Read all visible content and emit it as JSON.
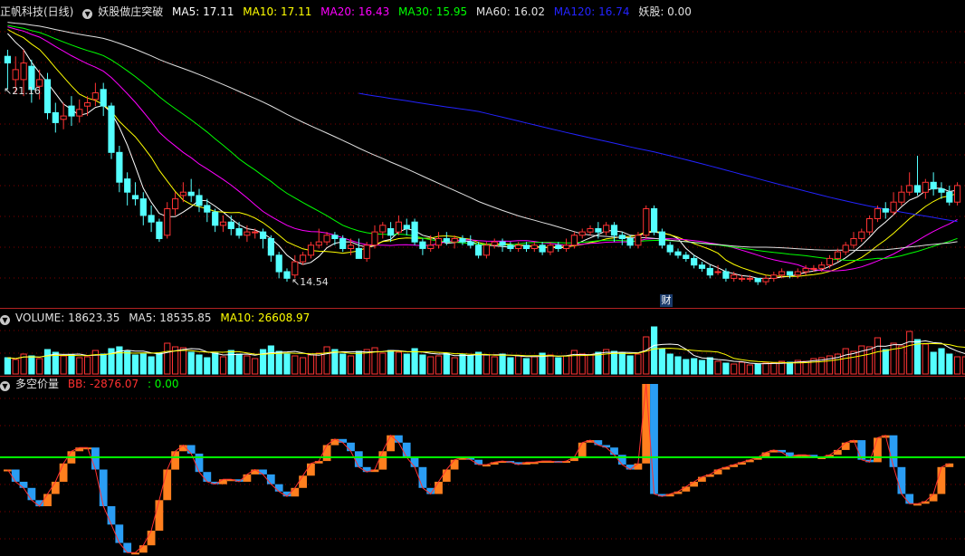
{
  "main_panel": {
    "stock_name": "正帆科技(日线)",
    "indicator_name": "妖股做庄突破",
    "ma_labels": [
      {
        "text": "MA5: 17.11",
        "color": "#ffffff"
      },
      {
        "text": "MA10: 17.11",
        "color": "#ffff00"
      },
      {
        "text": "MA20: 16.43",
        "color": "#ff00ff"
      },
      {
        "text": "MA30: 15.95",
        "color": "#00ff00"
      },
      {
        "text": "MA60: 16.02",
        "color": "#e0e0e0"
      },
      {
        "text": "MA120: 16.74",
        "color": "#2323ff"
      },
      {
        "text": "妖股: 0.00",
        "color": "#e0e0e0"
      }
    ],
    "high_marker": "21.16",
    "low_marker": "14.54",
    "cai_badge": "财"
  },
  "volume_panel": {
    "labels": [
      {
        "text": "VOLUME: 18623.35",
        "color": "#e0e0e0"
      },
      {
        "text": "MA5: 18535.85",
        "color": "#e0e0e0"
      },
      {
        "text": "MA10: 26608.97",
        "color": "#ffff00"
      }
    ]
  },
  "bb_panel": {
    "name": "多空价量",
    "labels": [
      {
        "text": "BB: -2876.07",
        "color": "#ff3030"
      },
      {
        "text": ": 0.00",
        "color": "#00ff00"
      }
    ]
  },
  "colors": {
    "up": "#ff3333",
    "down": "#54ffff",
    "bb_up": "#ff7f1e",
    "bb_down": "#2a9df4",
    "zero_line": "#00ff00",
    "grid": "#800000"
  },
  "chart_data": [
    {
      "type": "candlestick",
      "panel": "price",
      "ylim": [
        14.2,
        22.4
      ],
      "candles": [
        [
          21.3,
          21.1,
          21.5,
          20.3
        ],
        [
          20.6,
          20.9,
          21.3,
          20.2
        ],
        [
          20.6,
          21.1,
          21.5,
          20.1
        ],
        [
          21.0,
          20.3,
          21.2,
          19.9
        ],
        [
          20.4,
          20.6,
          20.9,
          20.0
        ],
        [
          20.6,
          19.6,
          20.8,
          19.4
        ],
        [
          19.6,
          19.3,
          19.9,
          19.0
        ],
        [
          19.4,
          19.5,
          19.9,
          19.1
        ],
        [
          19.8,
          19.5,
          20.1,
          19.2
        ],
        [
          19.5,
          19.7,
          20.0,
          19.3
        ],
        [
          19.8,
          19.9,
          20.1,
          19.5
        ],
        [
          20.0,
          20.2,
          20.5,
          19.8
        ],
        [
          20.3,
          19.8,
          20.5,
          19.5
        ],
        [
          19.8,
          18.4,
          19.9,
          18.2
        ],
        [
          18.4,
          17.5,
          18.6,
          17.2
        ],
        [
          17.6,
          17.2,
          17.8,
          16.8
        ],
        [
          17.1,
          17.0,
          17.5,
          16.8
        ],
        [
          17.0,
          16.5,
          17.2,
          16.2
        ],
        [
          16.5,
          16.3,
          16.8,
          16.0
        ],
        [
          16.3,
          15.8,
          16.4,
          15.7
        ],
        [
          15.9,
          16.7,
          16.9,
          15.8
        ],
        [
          16.7,
          17.0,
          17.2,
          16.5
        ],
        [
          17.1,
          17.2,
          17.5,
          16.9
        ],
        [
          17.2,
          17.1,
          17.6,
          16.9
        ],
        [
          17.1,
          16.8,
          17.3,
          16.6
        ],
        [
          16.8,
          16.6,
          17.0,
          16.3
        ],
        [
          16.6,
          16.2,
          16.7,
          16.0
        ],
        [
          16.2,
          16.3,
          16.5,
          16.0
        ],
        [
          16.3,
          16.1,
          16.5,
          15.9
        ],
        [
          16.1,
          15.9,
          16.3,
          15.8
        ],
        [
          15.9,
          16.0,
          16.2,
          15.7
        ],
        [
          16.0,
          16.0,
          16.1,
          15.8
        ],
        [
          16.0,
          15.8,
          16.1,
          15.5
        ],
        [
          15.8,
          15.3,
          15.9,
          15.1
        ],
        [
          15.3,
          14.8,
          15.4,
          14.6
        ],
        [
          14.8,
          14.6,
          14.9,
          14.5
        ],
        [
          14.7,
          15.1,
          15.3,
          14.6
        ],
        [
          15.1,
          15.3,
          15.4,
          15.0
        ],
        [
          15.3,
          15.6,
          15.7,
          15.2
        ],
        [
          15.6,
          15.7,
          16.1,
          15.5
        ],
        [
          15.7,
          15.9,
          16.0,
          15.6
        ],
        [
          15.9,
          15.8,
          16.0,
          15.6
        ],
        [
          15.8,
          15.5,
          15.9,
          15.4
        ],
        [
          15.5,
          15.6,
          15.8,
          15.3
        ],
        [
          15.5,
          15.2,
          15.8,
          15.2
        ],
        [
          15.2,
          15.6,
          15.7,
          15.1
        ],
        [
          15.6,
          16.0,
          16.2,
          15.5
        ],
        [
          16.0,
          16.2,
          16.3,
          15.8
        ],
        [
          16.1,
          15.9,
          16.3,
          15.7
        ],
        [
          16.0,
          16.3,
          16.5,
          15.9
        ],
        [
          16.2,
          16.1,
          16.4,
          15.9
        ],
        [
          16.3,
          15.7,
          16.4,
          15.6
        ],
        [
          15.7,
          15.5,
          15.8,
          15.3
        ],
        [
          15.5,
          15.6,
          15.9,
          15.4
        ],
        [
          15.6,
          15.8,
          16.0,
          15.5
        ],
        [
          15.8,
          15.7,
          16.0,
          15.6
        ],
        [
          15.7,
          15.8,
          15.9,
          15.5
        ],
        [
          15.8,
          15.7,
          15.9,
          15.6
        ],
        [
          15.7,
          15.6,
          15.9,
          15.5
        ],
        [
          15.6,
          15.3,
          15.7,
          15.2
        ],
        [
          15.3,
          15.6,
          15.7,
          15.2
        ],
        [
          15.6,
          15.7,
          15.8,
          15.5
        ],
        [
          15.7,
          15.6,
          15.8,
          15.4
        ],
        [
          15.6,
          15.5,
          15.7,
          15.4
        ],
        [
          15.5,
          15.6,
          15.7,
          15.4
        ],
        [
          15.6,
          15.5,
          15.7,
          15.4
        ],
        [
          15.5,
          15.6,
          15.7,
          15.4
        ],
        [
          15.6,
          15.4,
          15.7,
          15.3
        ],
        [
          15.4,
          15.6,
          15.7,
          15.3
        ],
        [
          15.6,
          15.5,
          15.7,
          15.4
        ],
        [
          15.5,
          15.6,
          15.8,
          15.4
        ],
        [
          15.6,
          15.9,
          16.0,
          15.5
        ],
        [
          15.9,
          16.0,
          16.1,
          15.8
        ],
        [
          16.0,
          16.1,
          16.2,
          15.9
        ],
        [
          16.1,
          16.0,
          16.3,
          15.8
        ],
        [
          16.0,
          16.2,
          16.3,
          15.9
        ],
        [
          16.2,
          15.9,
          16.3,
          15.7
        ],
        [
          15.9,
          15.8,
          16.0,
          15.6
        ],
        [
          15.8,
          15.6,
          15.9,
          15.5
        ],
        [
          15.6,
          15.9,
          16.0,
          15.5
        ],
        [
          15.9,
          16.7,
          16.8,
          15.8
        ],
        [
          16.7,
          16.0,
          16.8,
          15.9
        ],
        [
          16.0,
          15.6,
          16.1,
          15.5
        ],
        [
          15.6,
          15.4,
          15.7,
          15.3
        ],
        [
          15.4,
          15.3,
          15.5,
          15.2
        ],
        [
          15.3,
          15.2,
          15.4,
          15.1
        ],
        [
          15.2,
          15.0,
          15.3,
          14.9
        ],
        [
          15.0,
          14.9,
          15.1,
          14.8
        ],
        [
          14.9,
          14.7,
          15.0,
          14.6
        ],
        [
          14.8,
          14.8,
          15.0,
          14.7
        ],
        [
          14.8,
          14.6,
          14.9,
          14.5
        ],
        [
          14.6,
          14.7,
          14.8,
          14.5
        ],
        [
          14.6,
          14.6,
          14.7,
          14.5
        ],
        [
          14.6,
          14.6,
          14.7,
          14.5
        ],
        [
          14.6,
          14.5,
          14.6,
          14.4
        ],
        [
          14.5,
          14.6,
          14.7,
          14.4
        ],
        [
          14.6,
          14.7,
          14.8,
          14.5
        ],
        [
          14.7,
          14.8,
          14.9,
          14.6
        ],
        [
          14.8,
          14.7,
          14.8,
          14.6
        ],
        [
          14.7,
          14.8,
          14.9,
          14.6
        ],
        [
          14.8,
          14.9,
          15.0,
          14.7
        ],
        [
          14.9,
          14.9,
          15.0,
          14.8
        ],
        [
          14.9,
          15.0,
          15.1,
          14.8
        ],
        [
          15.0,
          15.2,
          15.3,
          14.9
        ],
        [
          15.2,
          15.4,
          15.5,
          15.1
        ],
        [
          15.4,
          15.6,
          15.7,
          15.3
        ],
        [
          15.6,
          15.8,
          16.0,
          15.5
        ],
        [
          15.8,
          16.0,
          16.1,
          15.7
        ],
        [
          16.0,
          16.4,
          16.5,
          15.9
        ],
        [
          16.4,
          16.7,
          16.8,
          16.3
        ],
        [
          16.7,
          16.6,
          16.9,
          16.4
        ],
        [
          16.6,
          16.9,
          17.2,
          16.5
        ],
        [
          16.9,
          17.2,
          17.4,
          16.8
        ],
        [
          17.2,
          17.4,
          17.8,
          17.1
        ],
        [
          17.4,
          17.2,
          18.3,
          17.1
        ],
        [
          17.2,
          17.5,
          17.6,
          17.0
        ],
        [
          17.5,
          17.3,
          17.8,
          17.1
        ],
        [
          17.3,
          17.2,
          17.5,
          17.0
        ],
        [
          17.2,
          16.9,
          17.4,
          16.8
        ],
        [
          16.9,
          17.4,
          17.5,
          16.8
        ]
      ],
      "annotations": [
        "21.16",
        "14.54",
        "财"
      ]
    },
    {
      "type": "bar",
      "panel": "volume",
      "series": [
        {
          "name": "VOLUME",
          "values": [
            18,
            16,
            22,
            20,
            17,
            27,
            24,
            20,
            21,
            18,
            19,
            26,
            22,
            28,
            30,
            25,
            21,
            22,
            19,
            23,
            34,
            30,
            29,
            24,
            21,
            18,
            23,
            19,
            26,
            22,
            20,
            17,
            27,
            31,
            25,
            22,
            20,
            18,
            21,
            23,
            30,
            27,
            22,
            20,
            25,
            27,
            29,
            23,
            26,
            24,
            22,
            28,
            21,
            19,
            20,
            23,
            18,
            22,
            20,
            24,
            21,
            19,
            22,
            18,
            20,
            17,
            19,
            23,
            21,
            18,
            20,
            26,
            22,
            21,
            24,
            27,
            25,
            23,
            20,
            22,
            41,
            52,
            28,
            22,
            19,
            16,
            17,
            15,
            18,
            14,
            12,
            11,
            13,
            10,
            11,
            12,
            12,
            14,
            13,
            15,
            14,
            17,
            18,
            20,
            22,
            28,
            25,
            31,
            30,
            40,
            27,
            34,
            31,
            47,
            38,
            33,
            24,
            28,
            22,
            19,
            19
          ]
        },
        {
          "name": "MA5",
          "values": []
        },
        {
          "name": "MA10",
          "values": []
        }
      ]
    },
    {
      "type": "bar",
      "panel": "bb",
      "zero": 0,
      "series": [
        {
          "name": "BB",
          "values": [
            -10,
            -20,
            -25,
            -35,
            -40,
            -30,
            -20,
            -5,
            5,
            8,
            8,
            -10,
            -40,
            -55,
            -70,
            -78,
            -78,
            -72,
            -60,
            -35,
            -10,
            5,
            10,
            3,
            -12,
            -20,
            -22,
            -18,
            -18,
            -20,
            -14,
            -10,
            -14,
            -22,
            -28,
            -32,
            -25,
            -15,
            -5,
            -3,
            10,
            15,
            12,
            5,
            -8,
            -12,
            -10,
            5,
            18,
            12,
            0,
            -8,
            -25,
            -30,
            -20,
            -10,
            -2,
            0,
            -2,
            -6,
            -6,
            -4,
            -3,
            -4,
            -6,
            -4,
            -4,
            -3,
            -3,
            -4,
            -3,
            0,
            12,
            14,
            10,
            8,
            2,
            -6,
            -10,
            -5,
            60,
            -30,
            -32,
            -30,
            -28,
            -24,
            -20,
            -16,
            -14,
            -10,
            -8,
            -6,
            -4,
            -2,
            0,
            4,
            6,
            4,
            0,
            2,
            2,
            0,
            0,
            2,
            6,
            12,
            14,
            -2,
            -4,
            16,
            18,
            -8,
            -30,
            -38,
            -38,
            -36,
            -30,
            -8,
            -5
          ]
        },
        {
          "name": "",
          "values": []
        }
      ]
    }
  ]
}
